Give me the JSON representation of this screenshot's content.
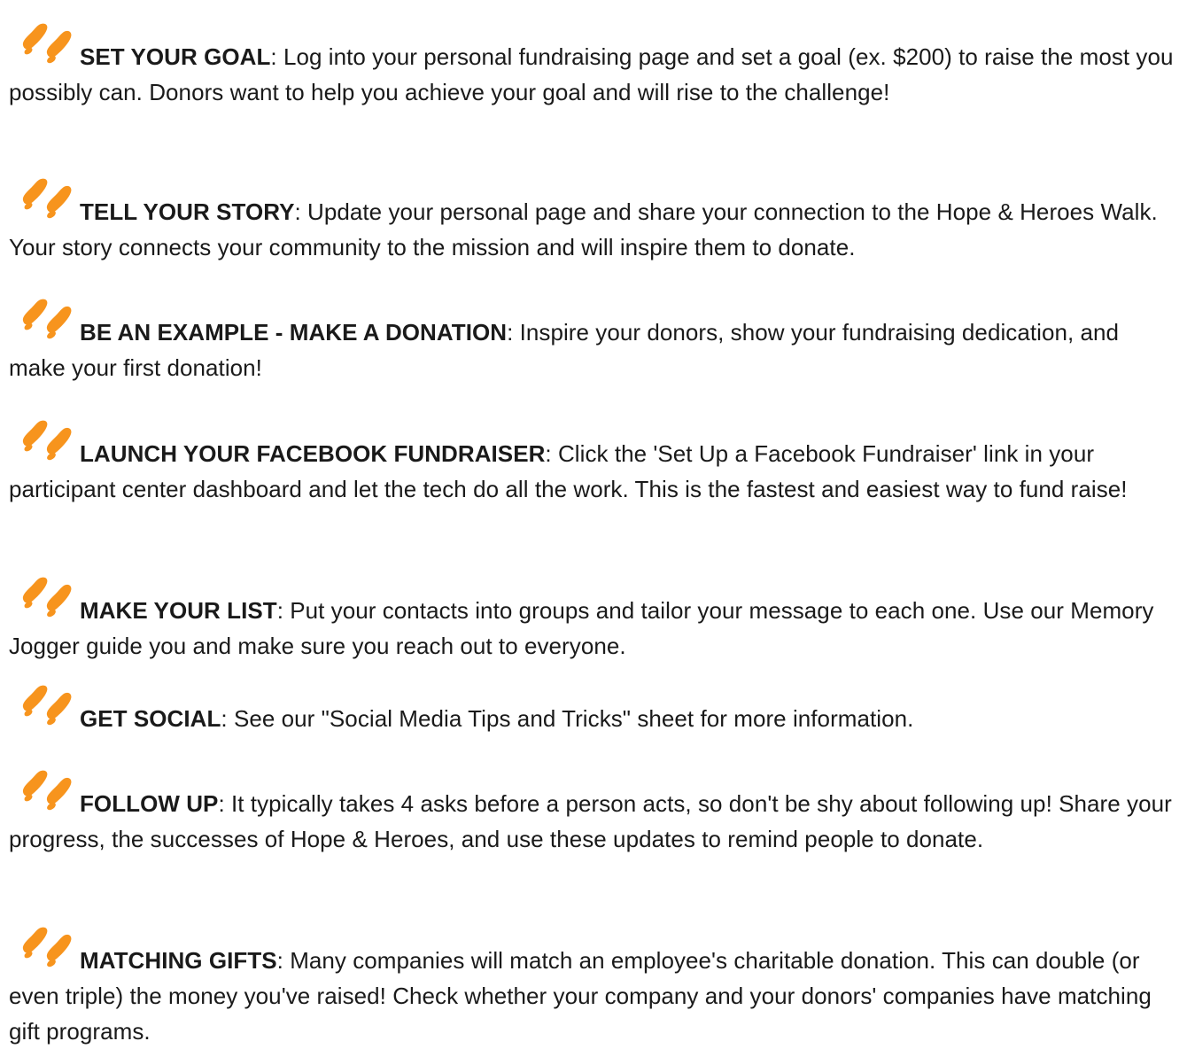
{
  "icons": {
    "footprints": "footprints-icon",
    "color": "#F7941D"
  },
  "tips": [
    {
      "heading": "SET YOUR GOAL",
      "body": ": Log into your personal fundraising page and set a goal (ex. $200) to raise the most you possibly can. Donors want to help you achieve your goal and will rise to the challenge!"
    },
    {
      "heading": "TELL YOUR STORY",
      "body": ": Update your personal page and share your connection to the Hope & Heroes Walk. Your story connects your community to the mission and will inspire them to donate."
    },
    {
      "heading": "BE AN EXAMPLE - MAKE A DONATION",
      "body": ": Inspire your donors, show your fundraising dedication, and make your first donation!"
    },
    {
      "heading": "LAUNCH YOUR FACEBOOK FUNDRAISER",
      "body": ": Click the 'Set Up a Facebook Fundraiser' link in your participant center dashboard and let the tech do all the work. This is the fastest and easiest way to fund raise!"
    },
    {
      "heading": "MAKE YOUR LIST",
      "body": ": Put your contacts into groups and tailor your message to each one. Use our Memory Jogger guide you and make sure you reach out to everyone."
    },
    {
      "heading": "GET SOCIAL",
      "body": ": See our \"Social Media Tips and Tricks\" sheet for more information."
    },
    {
      "heading": "FOLLOW UP",
      "body": ": It typically takes 4 asks before a person acts, so don't be shy about following up! Share your progress, the successes of Hope & Heroes, and use these updates to remind people to donate."
    },
    {
      "heading": "MATCHING GIFTS",
      "body": ": Many companies will match an employee's charitable donation. This can double (or even triple) the money you've raised! Check whether your company and your donors' companies have matching gift programs."
    }
  ]
}
